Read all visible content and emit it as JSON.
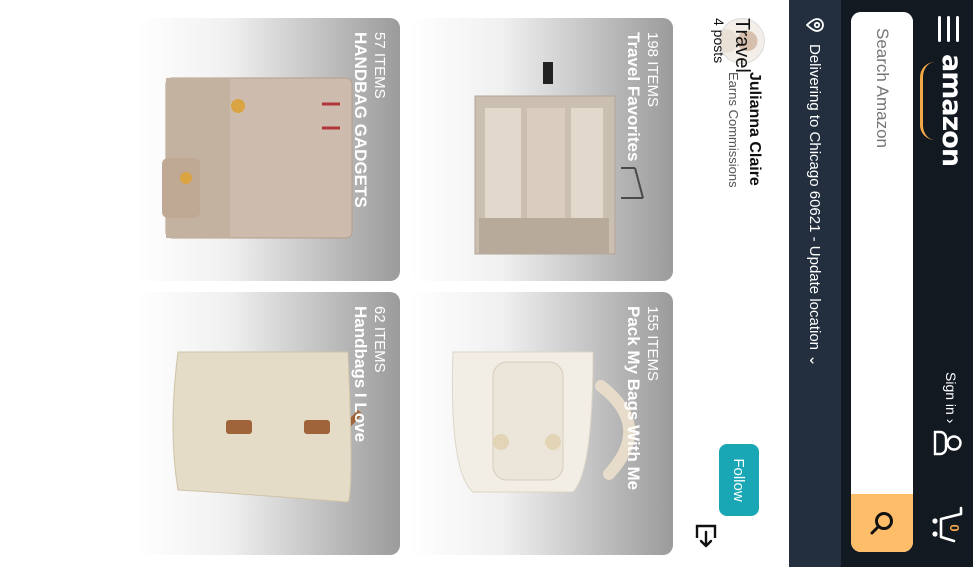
{
  "header": {
    "logo": "amazon",
    "sign_in": "Sign in ›",
    "cart_count": "0",
    "search_placeholder": "Search Amazon",
    "icons": [
      "menu-icon",
      "user-icon",
      "cart-icon",
      "search-icon"
    ]
  },
  "delivery": {
    "text": "Delivering to Chicago 60621 - Update location ⌄",
    "icon": "location-pin-icon"
  },
  "profile": {
    "name": "Julianna Claire",
    "subtitle": "Earns Commissions",
    "follow_label": "Follow"
  },
  "collection": {
    "title": "Travel",
    "posts": "4 posts",
    "share_icon": "share-icon"
  },
  "cards": [
    {
      "count": "198 ITEMS",
      "name": "Travel Favorites"
    },
    {
      "count": "57 ITEMS",
      "name": "HANDBAG GADGETS"
    },
    {
      "count": "155 ITEMS",
      "name": "Pack My Bags With Me"
    },
    {
      "count": "62 ITEMS",
      "name": "Handbags I Love"
    }
  ],
  "colors": {
    "topbar": "#131921",
    "delivery_bar": "#232f3e",
    "search_button": "#febd69",
    "follow": "#1aa7b5",
    "logo_smile": "#f3a847"
  }
}
